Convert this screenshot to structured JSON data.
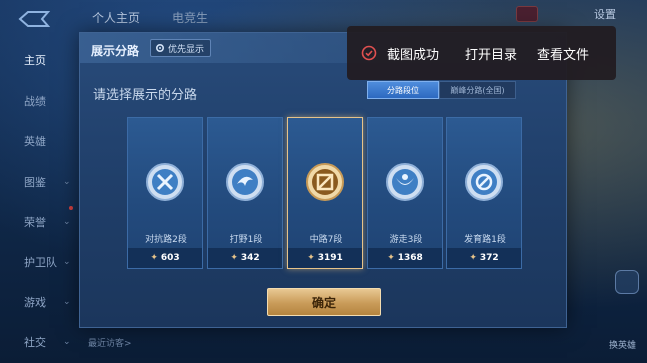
{
  "nav": {
    "items": [
      {
        "label": "主页",
        "chevron": false
      },
      {
        "label": "战绩",
        "chevron": false
      },
      {
        "label": "英雄",
        "chevron": false
      },
      {
        "label": "图鉴",
        "chevron": true
      },
      {
        "label": "荣誉",
        "chevron": true
      },
      {
        "label": "护卫队",
        "chevron": true
      },
      {
        "label": "游戏",
        "chevron": true
      },
      {
        "label": "社交",
        "chevron": true
      }
    ]
  },
  "top": {
    "tab_personal": "个人主页",
    "tab_esports": "电竞生",
    "settings": "设置"
  },
  "bottom": {
    "visitor_text": "最近访客>",
    "side_label": "换英雄"
  },
  "modal": {
    "title": "展示分路",
    "priority_label": "优先显示",
    "subtitle": "请选择展示的分路",
    "seg_rank": "分路段位",
    "seg_peak": "巅峰分路(全国)",
    "confirm": "确定",
    "lanes": [
      {
        "name": "对抗路2段",
        "score": "603",
        "icon": "clash-lane-icon",
        "selected": false
      },
      {
        "name": "打野1段",
        "score": "342",
        "icon": "jungle-icon",
        "selected": false
      },
      {
        "name": "中路7段",
        "score": "3191",
        "icon": "mid-lane-icon",
        "selected": true
      },
      {
        "name": "游走3段",
        "score": "1368",
        "icon": "roam-icon",
        "selected": false
      },
      {
        "name": "发育路1段",
        "score": "372",
        "icon": "farm-lane-icon",
        "selected": false
      }
    ]
  },
  "toast": {
    "message": "截图成功",
    "open_dir": "打开目录",
    "view_file": "查看文件"
  },
  "colors": {
    "accent_gold": "#e6c38a",
    "toast_icon": "#e05050",
    "card_blue": "#2c5a92"
  }
}
